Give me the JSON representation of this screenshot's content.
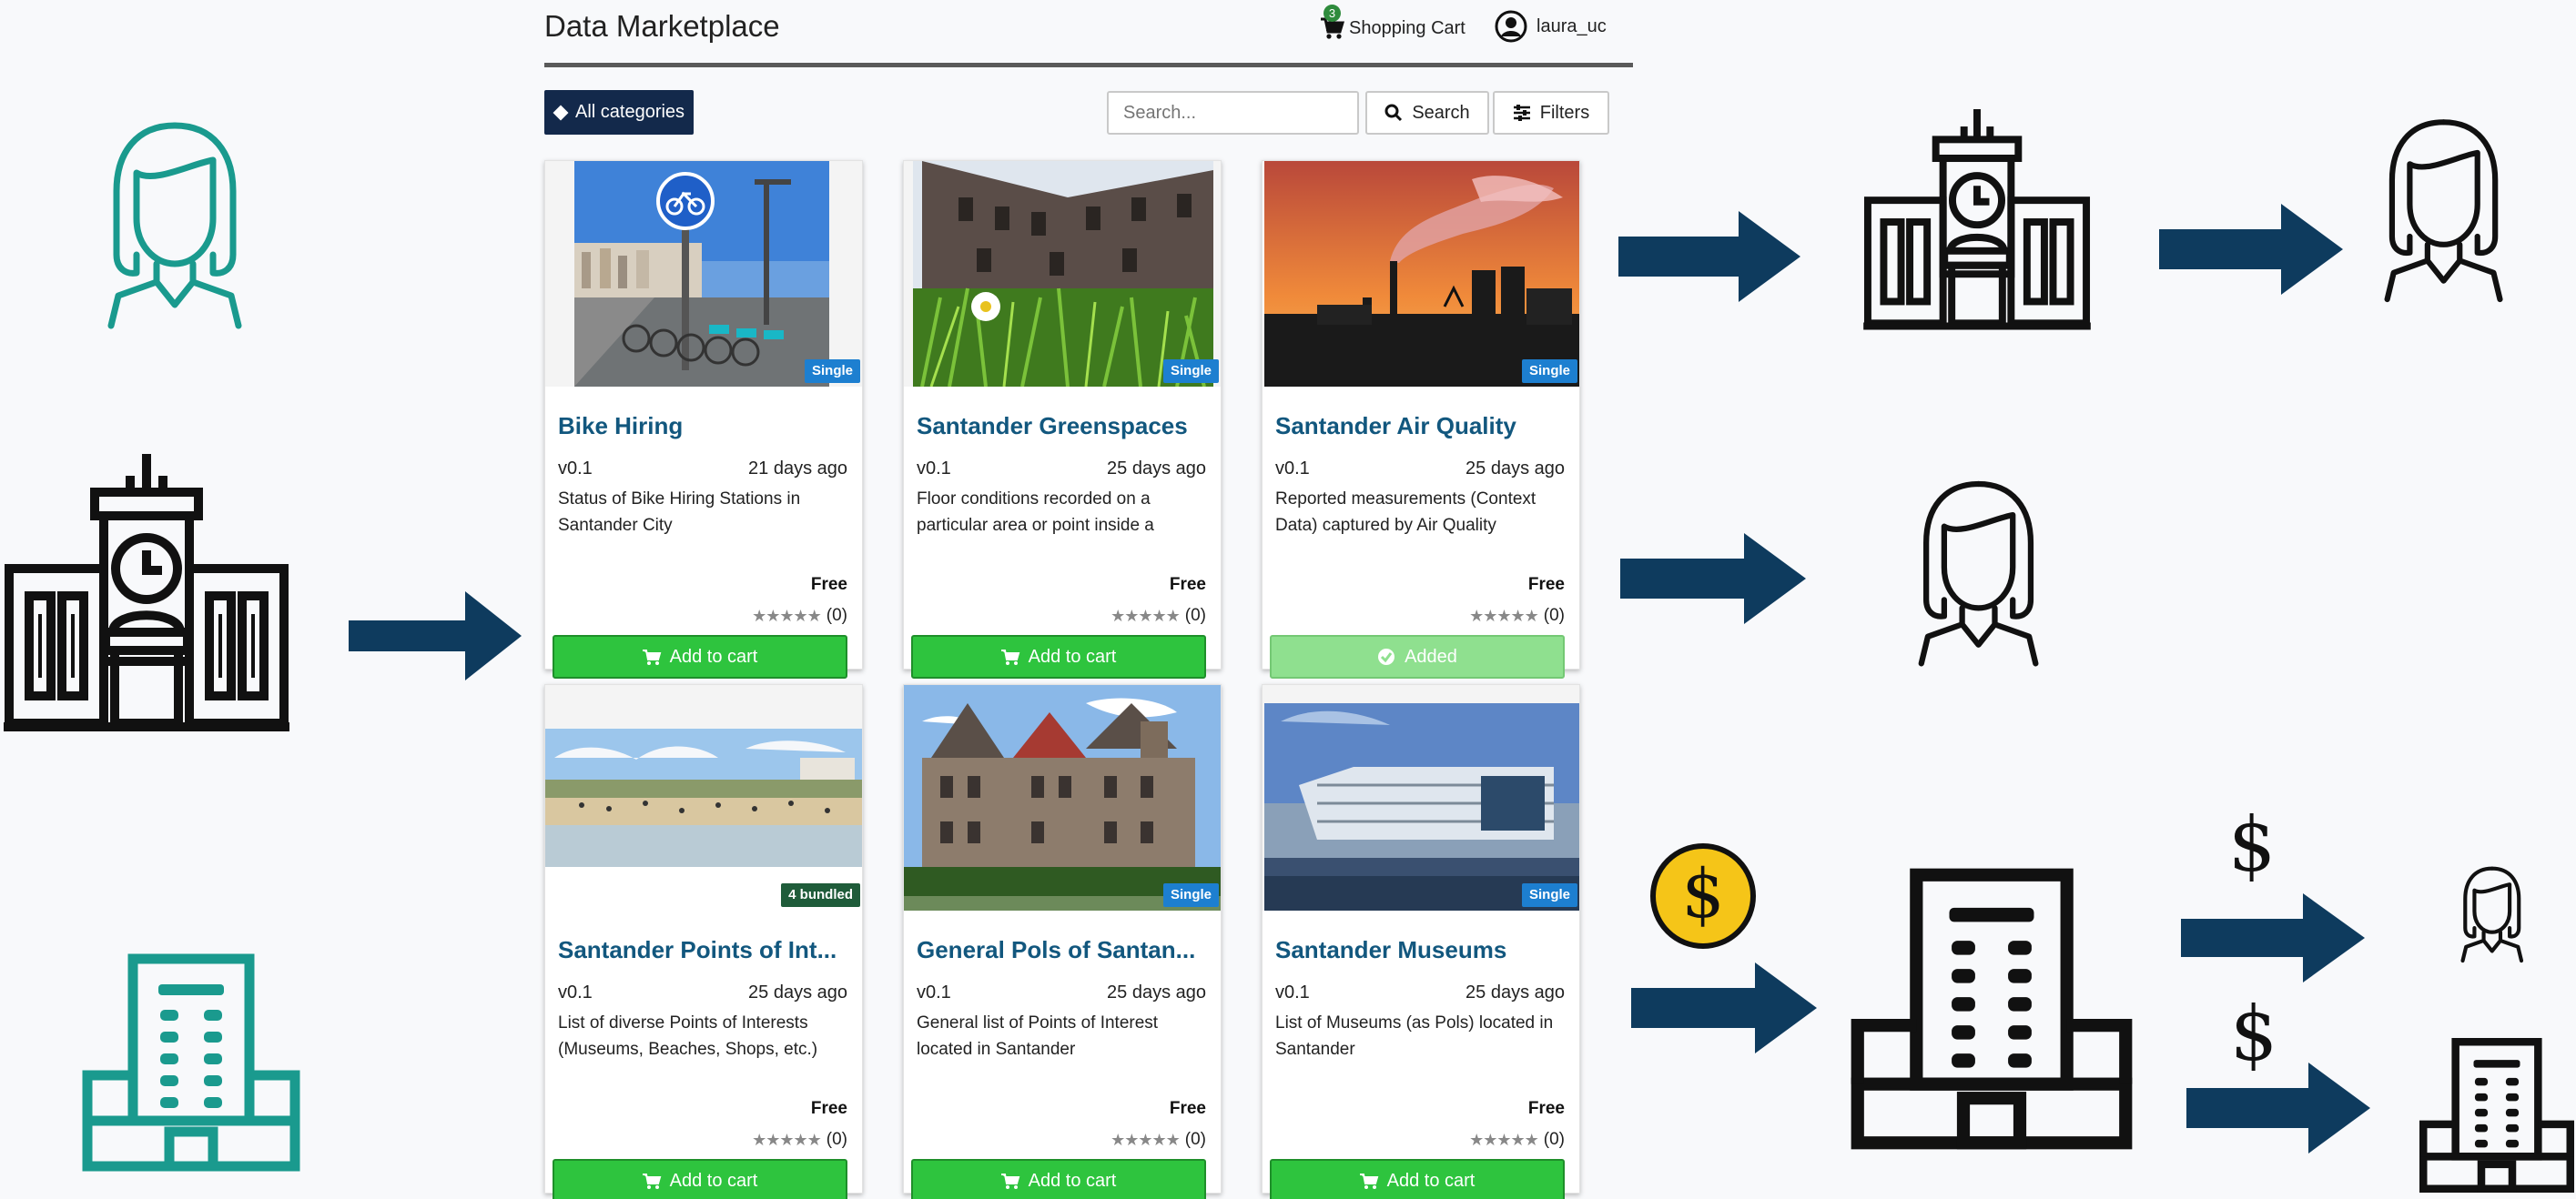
{
  "app": {
    "title": "Data Marketplace",
    "cart_label": "Shopping Cart",
    "cart_count": "3",
    "username": "laura_uc"
  },
  "toolbar": {
    "all_categories": "All categories",
    "search_placeholder": "Search...",
    "search_button": "Search",
    "filters_button": "Filters"
  },
  "products": [
    {
      "title": "Bike Hiring",
      "version": "v0.1",
      "age": "21 days ago",
      "desc": "Status of Bike Hiring Stations in Santander City",
      "price": "Free",
      "rating_count": "(0)",
      "tag": "Single",
      "button": "Add to cart",
      "image": "bike-station-photo"
    },
    {
      "title": "Santander Greenspaces",
      "version": "v0.1",
      "age": "25 days ago",
      "desc": "Floor conditions recorded on a particular area or point inside a",
      "price": "Free",
      "rating_count": "(0)",
      "tag": "Single",
      "button": "Add to cart",
      "image": "greenspace-photo"
    },
    {
      "title": "Santander Air Quality",
      "version": "v0.1",
      "age": "25 days ago",
      "desc": "Reported measurements (Context Data) captured by Air Quality",
      "price": "Free",
      "rating_count": "(0)",
      "tag": "Single",
      "button": "Added",
      "image": "factory-smoke-photo"
    },
    {
      "title": "Santander Points of Int...",
      "version": "v0.1",
      "age": "25 days ago",
      "desc": "List of diverse Points of Interests (Museums, Beaches, Shops, etc.)",
      "price": "Free",
      "rating_count": "(0)",
      "tag": "4 bundled",
      "button": "Add to cart",
      "image": "beach-photo"
    },
    {
      "title": "General Pols of Santan...",
      "version": "v0.1",
      "age": "25 days ago",
      "desc": "General list of Points of Interest located in Santander",
      "price": "Free",
      "rating_count": "(0)",
      "tag": "Single",
      "button": "Add to cart",
      "image": "palace-photo"
    },
    {
      "title": "Santander Museums",
      "version": "v0.1",
      "age": "25 days ago",
      "desc": "List of Museums (as Pols) located in Santander",
      "price": "Free",
      "rating_count": "(0)",
      "tag": "Single",
      "button": "Add to cart",
      "image": "museum-photo"
    }
  ],
  "diagram": {
    "dollar_1": "$",
    "dollar_2": "$",
    "coin_symbol": "$",
    "teal_color": "#1a9a8e",
    "arrow_color": "#0e3b5e",
    "coin_color": "#f5c518",
    "icons": [
      "woman-icon",
      "city-hall-icon",
      "office-building-icon",
      "arrow-icon",
      "dollar-coin-icon"
    ]
  }
}
